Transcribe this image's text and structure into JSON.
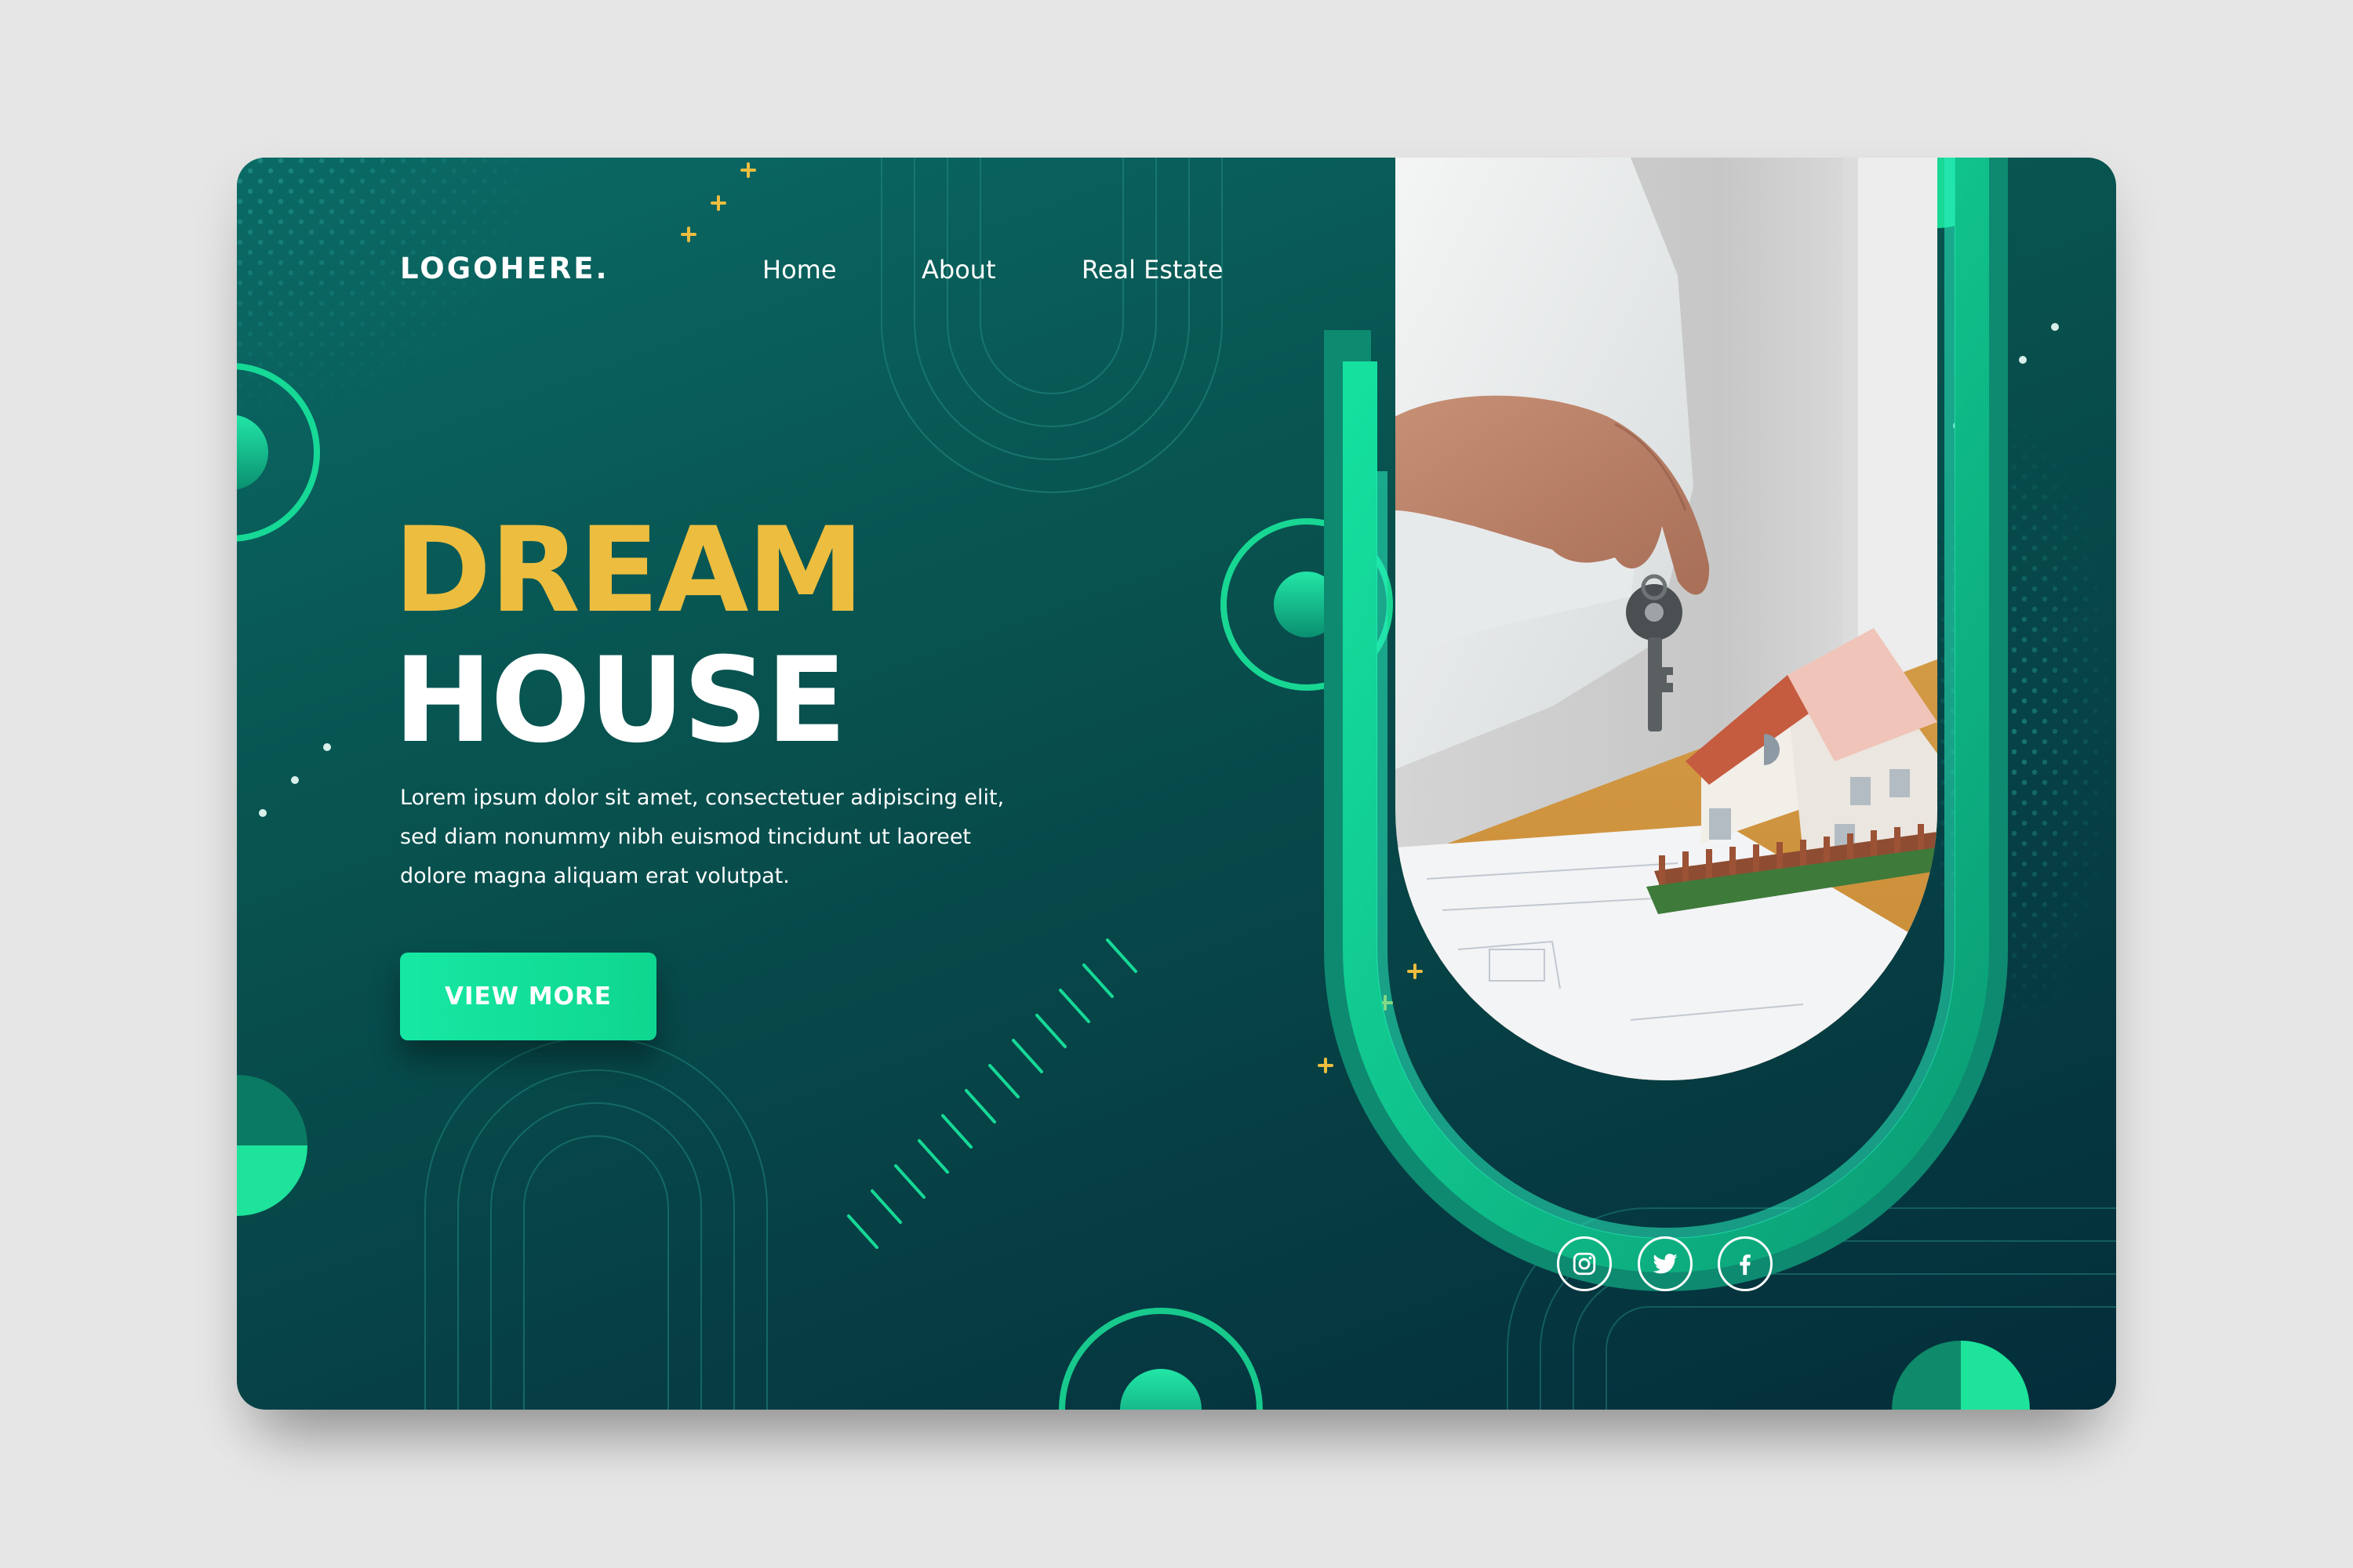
{
  "header": {
    "logo": "LOGOHERE.",
    "nav": [
      {
        "label": "Home"
      },
      {
        "label": "About"
      },
      {
        "label": "Real Estate"
      }
    ]
  },
  "hero": {
    "title_line1": "DREAM",
    "title_line2": "HOUSE",
    "body_lines": [
      "Lorem ipsum dolor sit amet, consectetuer adipiscing elit,",
      "sed diam nonummy nibh euismod tincidunt ut laoreet",
      "dolore magna aliquam erat volutpat."
    ],
    "cta_label": "VIEW MORE"
  },
  "social": [
    {
      "icon": "instagram-icon"
    },
    {
      "icon": "twitter-icon"
    },
    {
      "icon": "facebook-icon"
    }
  ],
  "colors": {
    "background": "#e6e6e6",
    "card": "#08524f",
    "accent_green": "#16e8a3",
    "title_yellow": "#edbd3f",
    "text": "#ffffff"
  }
}
